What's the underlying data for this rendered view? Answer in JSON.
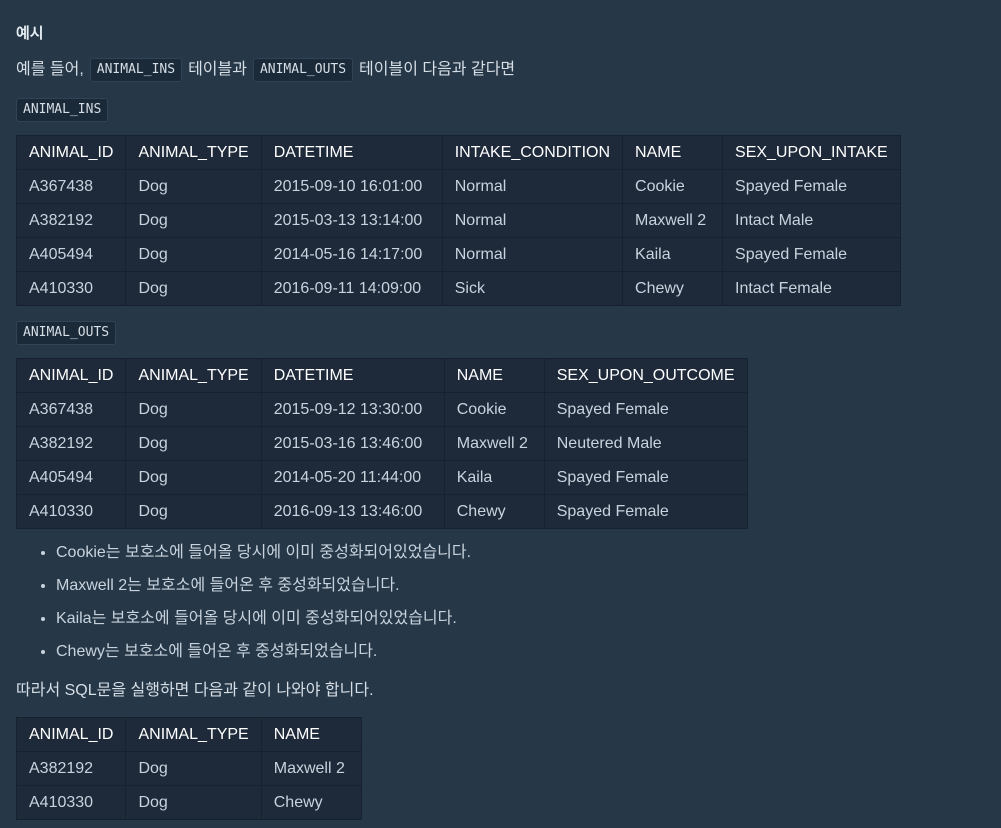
{
  "heading": "예시",
  "intro": {
    "prefix": "예를 들어,",
    "code1": "ANIMAL_INS",
    "middle": "테이블과",
    "code2": "ANIMAL_OUTS",
    "suffix": "테이블이 다음과 같다면"
  },
  "ins": {
    "label": "ANIMAL_INS",
    "headers": [
      "ANIMAL_ID",
      "ANIMAL_TYPE",
      "DATETIME",
      "INTAKE_CONDITION",
      "NAME",
      "SEX_UPON_INTAKE"
    ],
    "rows": [
      [
        "A367438",
        "Dog",
        "2015-09-10 16:01:00",
        "Normal",
        "Cookie",
        "Spayed Female"
      ],
      [
        "A382192",
        "Dog",
        "2015-03-13 13:14:00",
        "Normal",
        "Maxwell 2",
        "Intact Male"
      ],
      [
        "A405494",
        "Dog",
        "2014-05-16 14:17:00",
        "Normal",
        "Kaila",
        "Spayed Female"
      ],
      [
        "A410330",
        "Dog",
        "2016-09-11 14:09:00",
        "Sick",
        "Chewy",
        "Intact Female"
      ]
    ]
  },
  "outs": {
    "label": "ANIMAL_OUTS",
    "headers": [
      "ANIMAL_ID",
      "ANIMAL_TYPE",
      "DATETIME",
      "NAME",
      "SEX_UPON_OUTCOME"
    ],
    "rows": [
      [
        "A367438",
        "Dog",
        "2015-09-12 13:30:00",
        "Cookie",
        "Spayed Female"
      ],
      [
        "A382192",
        "Dog",
        "2015-03-16 13:46:00",
        "Maxwell 2",
        "Neutered Male"
      ],
      [
        "A405494",
        "Dog",
        "2014-05-20 11:44:00",
        "Kaila",
        "Spayed Female"
      ],
      [
        "A410330",
        "Dog",
        "2016-09-13 13:46:00",
        "Chewy",
        "Spayed Female"
      ]
    ]
  },
  "notes": [
    "Cookie는 보호소에 들어올 당시에 이미 중성화되어있었습니다.",
    "Maxwell 2는 보호소에 들어온 후 중성화되었습니다.",
    "Kaila는 보호소에 들어올 당시에 이미 중성화되어있었습니다.",
    "Chewy는 보호소에 들어온 후 중성화되었습니다."
  ],
  "conclusion": "따라서 SQL문을 실행하면 다음과 같이 나와야 합니다.",
  "result": {
    "headers": [
      "ANIMAL_ID",
      "ANIMAL_TYPE",
      "NAME"
    ],
    "rows": [
      [
        "A382192",
        "Dog",
        "Maxwell 2"
      ],
      [
        "A410330",
        "Dog",
        "Chewy"
      ]
    ]
  }
}
